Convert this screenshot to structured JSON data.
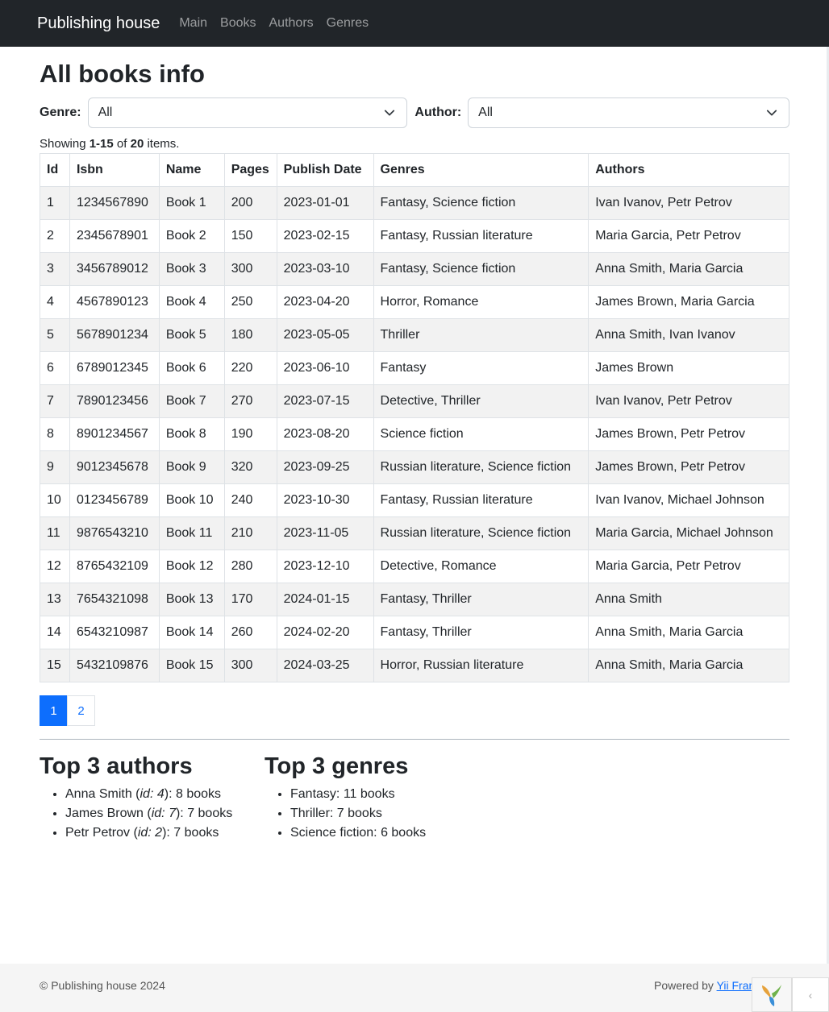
{
  "navbar": {
    "brand": "Publishing house",
    "links": [
      "Main",
      "Books",
      "Authors",
      "Genres"
    ]
  },
  "page": {
    "title": "All books info"
  },
  "filters": {
    "genre_label": "Genre:",
    "genre_value": "All",
    "author_label": "Author:",
    "author_value": "All"
  },
  "summary": {
    "prefix": "Showing ",
    "range": "1-15",
    "middle": " of ",
    "total": "20",
    "suffix": " items."
  },
  "table": {
    "headers": [
      "Id",
      "Isbn",
      "Name",
      "Pages",
      "Publish Date",
      "Genres",
      "Authors"
    ],
    "rows": [
      [
        "1",
        "1234567890",
        "Book 1",
        "200",
        "2023-01-01",
        "Fantasy, Science fiction",
        "Ivan Ivanov, Petr Petrov"
      ],
      [
        "2",
        "2345678901",
        "Book 2",
        "150",
        "2023-02-15",
        "Fantasy, Russian literature",
        "Maria Garcia, Petr Petrov"
      ],
      [
        "3",
        "3456789012",
        "Book 3",
        "300",
        "2023-03-10",
        "Fantasy, Science fiction",
        "Anna Smith, Maria Garcia"
      ],
      [
        "4",
        "4567890123",
        "Book 4",
        "250",
        "2023-04-20",
        "Horror, Romance",
        "James Brown, Maria Garcia"
      ],
      [
        "5",
        "5678901234",
        "Book 5",
        "180",
        "2023-05-05",
        "Thriller",
        "Anna Smith, Ivan Ivanov"
      ],
      [
        "6",
        "6789012345",
        "Book 6",
        "220",
        "2023-06-10",
        "Fantasy",
        "James Brown"
      ],
      [
        "7",
        "7890123456",
        "Book 7",
        "270",
        "2023-07-15",
        "Detective, Thriller",
        "Ivan Ivanov, Petr Petrov"
      ],
      [
        "8",
        "8901234567",
        "Book 8",
        "190",
        "2023-08-20",
        "Science fiction",
        "James Brown, Petr Petrov"
      ],
      [
        "9",
        "9012345678",
        "Book 9",
        "320",
        "2023-09-25",
        "Russian literature, Science fiction",
        "James Brown, Petr Petrov"
      ],
      [
        "10",
        "0123456789",
        "Book 10",
        "240",
        "2023-10-30",
        "Fantasy, Russian literature",
        "Ivan Ivanov, Michael Johnson"
      ],
      [
        "11",
        "9876543210",
        "Book 11",
        "210",
        "2023-11-05",
        "Russian literature, Science fiction",
        "Maria Garcia, Michael Johnson"
      ],
      [
        "12",
        "8765432109",
        "Book 12",
        "280",
        "2023-12-10",
        "Detective, Romance",
        "Maria Garcia, Petr Petrov"
      ],
      [
        "13",
        "7654321098",
        "Book 13",
        "170",
        "2024-01-15",
        "Fantasy, Thriller",
        "Anna Smith"
      ],
      [
        "14",
        "6543210987",
        "Book 14",
        "260",
        "2024-02-20",
        "Fantasy, Thriller",
        "Anna Smith, Maria Garcia"
      ],
      [
        "15",
        "5432109876",
        "Book 15",
        "300",
        "2024-03-25",
        "Horror, Russian literature",
        "Anna Smith, Maria Garcia"
      ]
    ]
  },
  "pagination": {
    "pages": [
      "1",
      "2"
    ],
    "active": "1"
  },
  "top_authors": {
    "title": "Top 3 authors",
    "items": [
      {
        "name": "Anna Smith",
        "id_label": "id:",
        "id": "4",
        "count": "8 books"
      },
      {
        "name": "James Brown",
        "id_label": "id:",
        "id": "7",
        "count": "7 books"
      },
      {
        "name": "Petr Petrov",
        "id_label": "id:",
        "id": "2",
        "count": "7 books"
      }
    ]
  },
  "top_genres": {
    "title": "Top 3 genres",
    "items": [
      {
        "name": "Fantasy",
        "count": "11 books"
      },
      {
        "name": "Thriller",
        "count": "7 books"
      },
      {
        "name": "Science fiction",
        "count": "6 books"
      }
    ]
  },
  "footer": {
    "copyright": "© Publishing house 2024",
    "powered_prefix": "Powered by ",
    "powered_link": "Yii Framework"
  },
  "colors": {
    "navbar_bg": "#212529",
    "accent": "#0d6efd",
    "stripe": "#f2f2f2"
  }
}
